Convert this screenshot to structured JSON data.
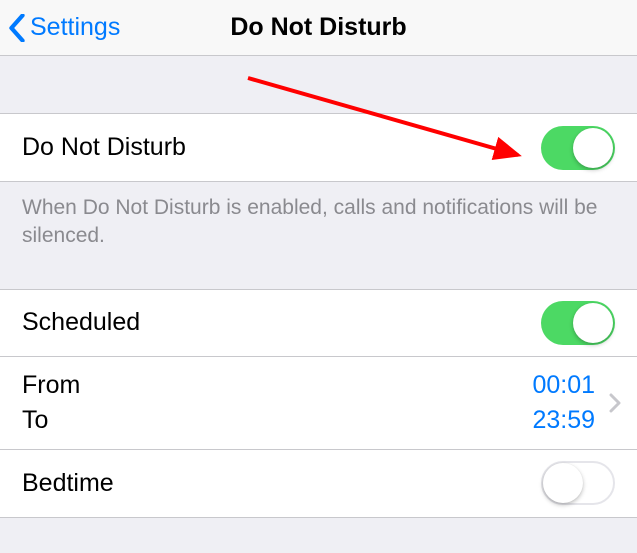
{
  "nav": {
    "back_label": "Settings",
    "title": "Do Not Disturb"
  },
  "dnd": {
    "label": "Do Not Disturb",
    "enabled": true,
    "footer": "When Do Not Disturb is enabled, calls and notifications will be silenced."
  },
  "scheduled": {
    "label": "Scheduled",
    "enabled": true,
    "from_label": "From",
    "to_label": "To",
    "from_value": "00:01",
    "to_value": "23:59"
  },
  "bedtime": {
    "label": "Bedtime",
    "enabled": false
  },
  "arrow": {
    "color": "#ff0000"
  }
}
